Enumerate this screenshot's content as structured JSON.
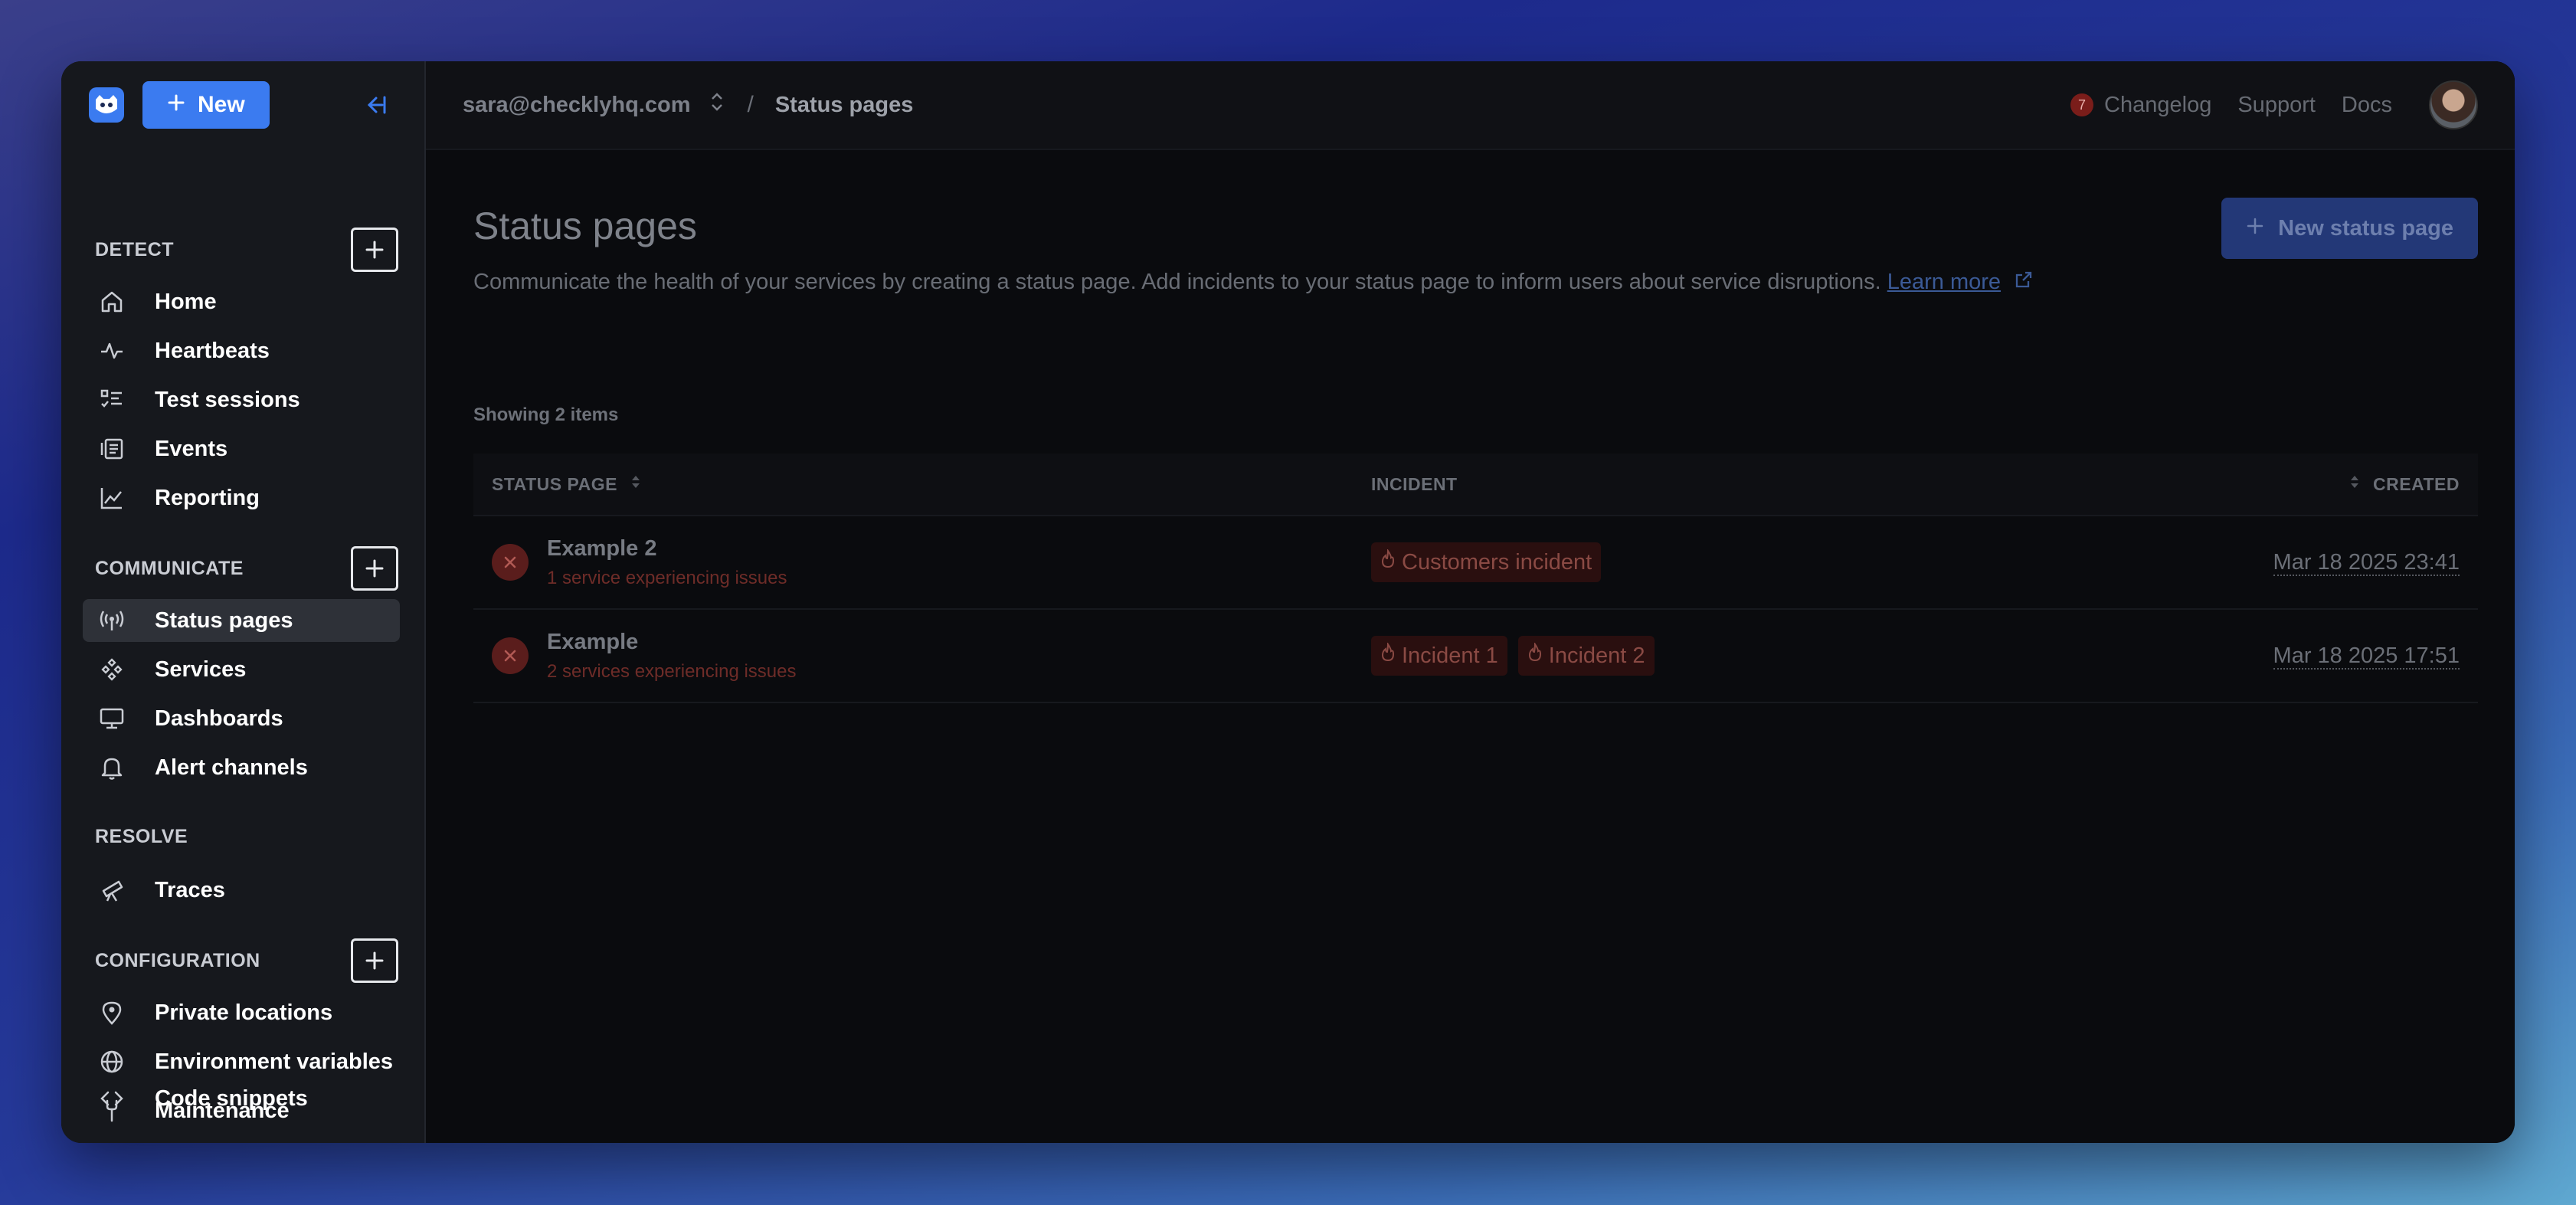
{
  "sidebar": {
    "new_label": "New",
    "sections": [
      {
        "title": "DETECT",
        "items": [
          "Home",
          "Heartbeats",
          "Test sessions",
          "Events",
          "Reporting"
        ]
      },
      {
        "title": "COMMUNICATE",
        "items": [
          "Status pages",
          "Services",
          "Dashboards",
          "Alert channels"
        ]
      },
      {
        "title": "RESOLVE",
        "items": [
          "Traces"
        ]
      },
      {
        "title": "CONFIGURATION",
        "items": [
          "Private locations",
          "Environment variables",
          "Maintenance",
          "Code snippets"
        ]
      }
    ],
    "active_item": "Status pages"
  },
  "topbar": {
    "account": "sara@checklyhq.com",
    "breadcrumb_sep": "/",
    "breadcrumb": "Status pages",
    "changelog_count": "7",
    "changelog": "Changelog",
    "support": "Support",
    "docs": "Docs"
  },
  "page": {
    "title": "Status pages",
    "description": "Communicate the health of your services by creating a status page. Add incidents to your status page to inform users about service disruptions.",
    "learn_more": "Learn more",
    "new_button": "New status page",
    "showing": "Showing 2 items"
  },
  "table": {
    "headers": {
      "status_page": "STATUS PAGE",
      "incident": "INCIDENT",
      "created": "CREATED"
    },
    "rows": [
      {
        "name": "Example 2",
        "sub": "1 service experiencing issues",
        "incidents": [
          "Customers incident"
        ],
        "created": "Mar 18 2025 23:41"
      },
      {
        "name": "Example",
        "sub": "2 services experiencing issues",
        "incidents": [
          "Incident 1",
          "Incident 2"
        ],
        "created": "Mar 18 2025 17:51"
      }
    ]
  },
  "colors": {
    "accent": "#3b7bf0",
    "danger": "#7a1d1a"
  }
}
